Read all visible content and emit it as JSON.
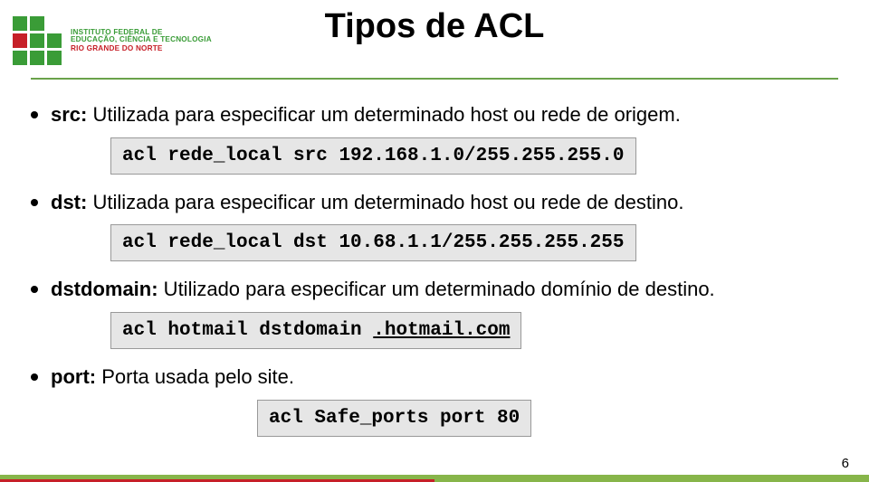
{
  "logo": {
    "line1": "INSTITUTO FEDERAL DE",
    "line2": "EDUCAÇÃO, CIÊNCIA E TECNOLOGIA",
    "line3": "RIO GRANDE DO NORTE"
  },
  "title": "Tipos de ACL",
  "bullets": [
    {
      "term": "src:",
      "text": " Utilizada para especificar um determinado host ou rede de origem."
    },
    {
      "term": "dst:",
      "text": " Utilizada para especificar um determinado host ou rede de destino."
    },
    {
      "term": "dstdomain:",
      "text": " Utilizado para especificar um determinado domínio de destino."
    },
    {
      "term": "port:",
      "text": " Porta usada pelo site."
    }
  ],
  "code": {
    "src": "acl rede_local src 192.168.1.0/255.255.255.0",
    "dst": "acl rede_local dst 10.68.1.1/255.255.255.255",
    "domain_pre": "acl hotmail dstdomain ",
    "domain_host": ".hotmail.com",
    "port": "acl Safe_ports port 80"
  },
  "page_number": "6"
}
